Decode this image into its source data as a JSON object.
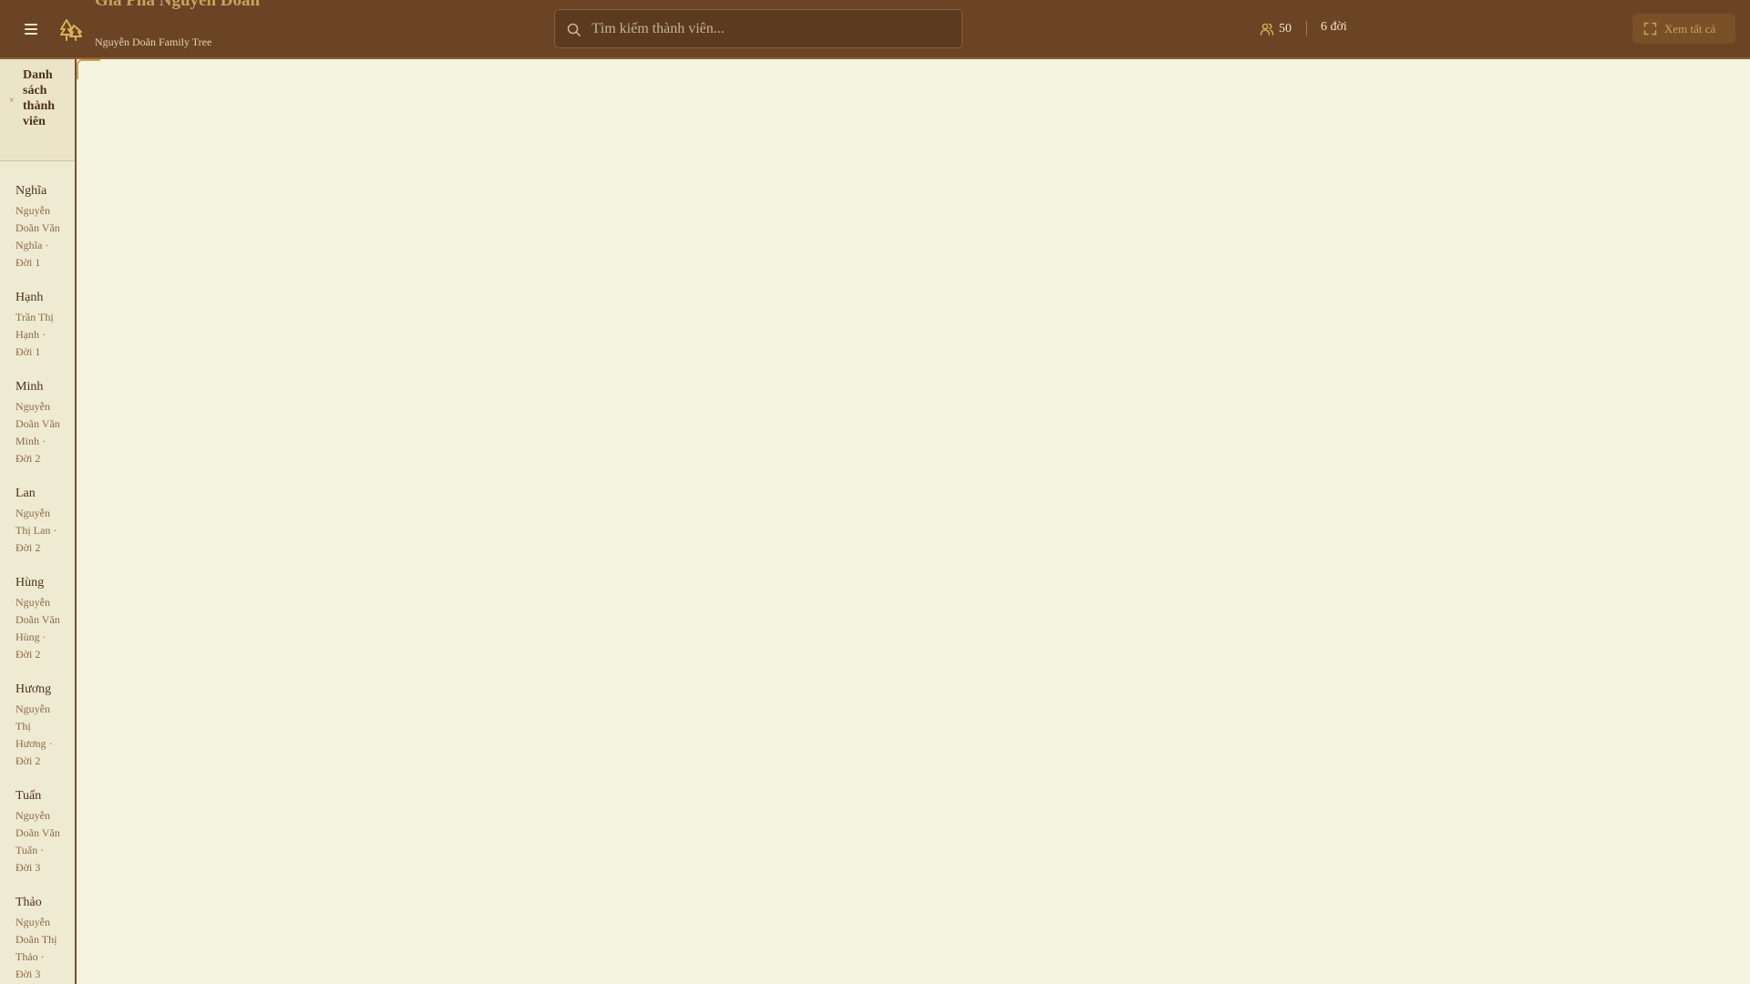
{
  "header": {
    "title": "Gia Phả Nguyễn Doãn",
    "subtitle": "Nguyễn Doãn Family Tree",
    "logo_icon": "tree-icon",
    "menu_icon": "hamburger-icon",
    "search": {
      "placeholder": "Tìm kiếm thành viên...",
      "value": "",
      "icon": "search-icon"
    },
    "stats": {
      "members_icon": "users-icon",
      "members_count": "50",
      "generations": "6 đời"
    },
    "view_all_label": "Xem tất cả",
    "view_all_icon": "expand-icon"
  },
  "sidebar": {
    "title": "Danh sách thành viên",
    "collapse_icon": "close-icon",
    "collapse_glyph": "×",
    "members": [
      {
        "short": "Nghĩa",
        "detail": "Nguyễn Doãn Văn Nghĩa · Đời 1"
      },
      {
        "short": "Hạnh",
        "detail": "Trần Thị Hạnh · Đời 1"
      },
      {
        "short": "Minh",
        "detail": "Nguyễn Doãn Văn Minh · Đời 2"
      },
      {
        "short": "Lan",
        "detail": "Nguyễn Thị Lan · Đời 2"
      },
      {
        "short": "Hùng",
        "detail": "Nguyễn Doãn Văn Hùng · Đời 2"
      },
      {
        "short": "Hương",
        "detail": "Nguyễn Thị Hương · Đời 2"
      },
      {
        "short": "Tuấn",
        "detail": "Nguyễn Doãn Văn Tuấn · Đời 3"
      },
      {
        "short": "Thảo",
        "detail": "Nguyễn Doãn Thị Thảo · Đời 3"
      }
    ]
  },
  "colors": {
    "header_bg": "#6b4425",
    "accent_gold": "#c9a25f",
    "canvas_bg": "#f5f4de",
    "sidebar_bg": "#efead2"
  }
}
